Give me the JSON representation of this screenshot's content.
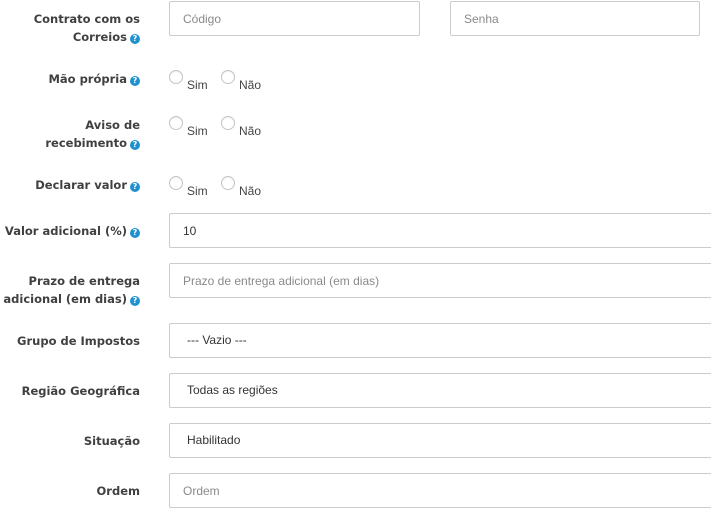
{
  "contrato": {
    "label_line1": "Contrato com os",
    "label_line2": "Correios",
    "codigo_placeholder": "Código",
    "senha_placeholder": "Senha"
  },
  "mao_propria": {
    "label": "Mão própria",
    "opt_sim": "Sim",
    "opt_nao": "Não"
  },
  "aviso": {
    "label_line1": "Aviso de",
    "label_line2": "recebimento",
    "opt_sim": "Sim",
    "opt_nao": "Não"
  },
  "declarar": {
    "label": "Declarar valor",
    "opt_sim": "Sim",
    "opt_nao": "Não"
  },
  "valor_adicional": {
    "label": "Valor adicional (%)",
    "value": "10"
  },
  "prazo": {
    "label_line1": "Prazo de entrega",
    "label_line2": "adicional (em dias)",
    "placeholder": "Prazo de entrega adicional (em dias)"
  },
  "grupo_impostos": {
    "label": "Grupo de Impostos",
    "selected": "--- Vazio ---"
  },
  "regiao": {
    "label": "Região Geográfica",
    "selected": "Todas as regiões"
  },
  "situacao": {
    "label": "Situação",
    "selected": "Habilitado"
  },
  "ordem": {
    "label": "Ordem",
    "placeholder": "Ordem"
  },
  "help_glyph": "?",
  "colors": {
    "help_icon": "#1e91cf",
    "border": "#cccccc",
    "label": "#404040"
  }
}
